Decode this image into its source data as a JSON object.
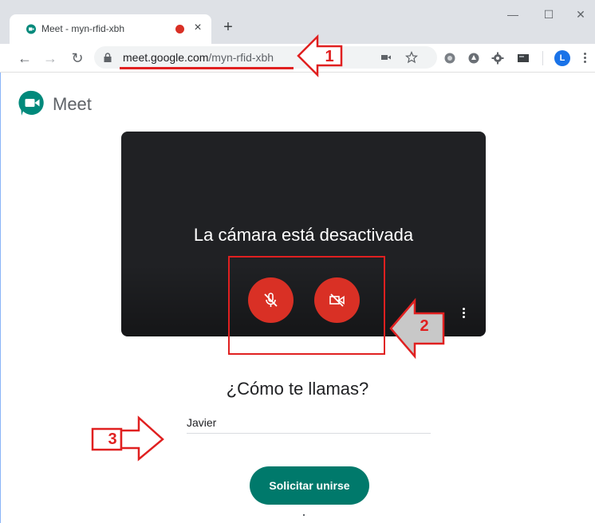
{
  "browser": {
    "tab_title": "Meet - myn-rfid-xbh",
    "url_host": "meet.google.com",
    "url_path": "/myn-rfid-xbh",
    "profile_initial": "L"
  },
  "meet": {
    "brand": "Meet",
    "camera_off_text": "La cámara está desactivada",
    "name_question": "¿Cómo te llamas?",
    "name_value": "Javier",
    "join_label": "Solicitar unirse"
  },
  "annotations": {
    "labels": [
      "1",
      "2",
      "3"
    ],
    "color": "#e02020"
  },
  "colors": {
    "mic_button": "#d93025",
    "join_button": "#00796b",
    "preview_bg": "#202124"
  }
}
